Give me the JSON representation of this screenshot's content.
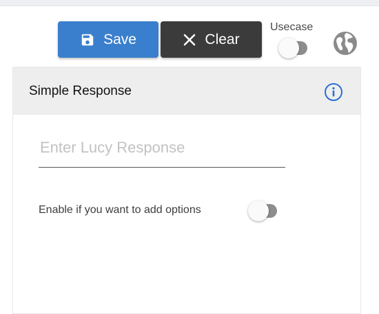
{
  "toolbar": {
    "save_label": "Save",
    "clear_label": "Clear",
    "usecase_label": "Usecase",
    "usecase_toggle_on": false,
    "save_icon": "save-icon",
    "clear_icon": "close-icon",
    "globe_icon": "globe-icon"
  },
  "card": {
    "title": "Simple Response",
    "info_icon": "info-icon",
    "response_placeholder": "Enter Lucy Response",
    "response_value": "",
    "options_label": "Enable if you want to add options",
    "options_toggle_on": false
  },
  "colors": {
    "save_button": "#3a7fcd",
    "clear_button": "#3b3b3b",
    "info_icon": "#2a6fd4",
    "header_bg": "#eeeeee"
  }
}
